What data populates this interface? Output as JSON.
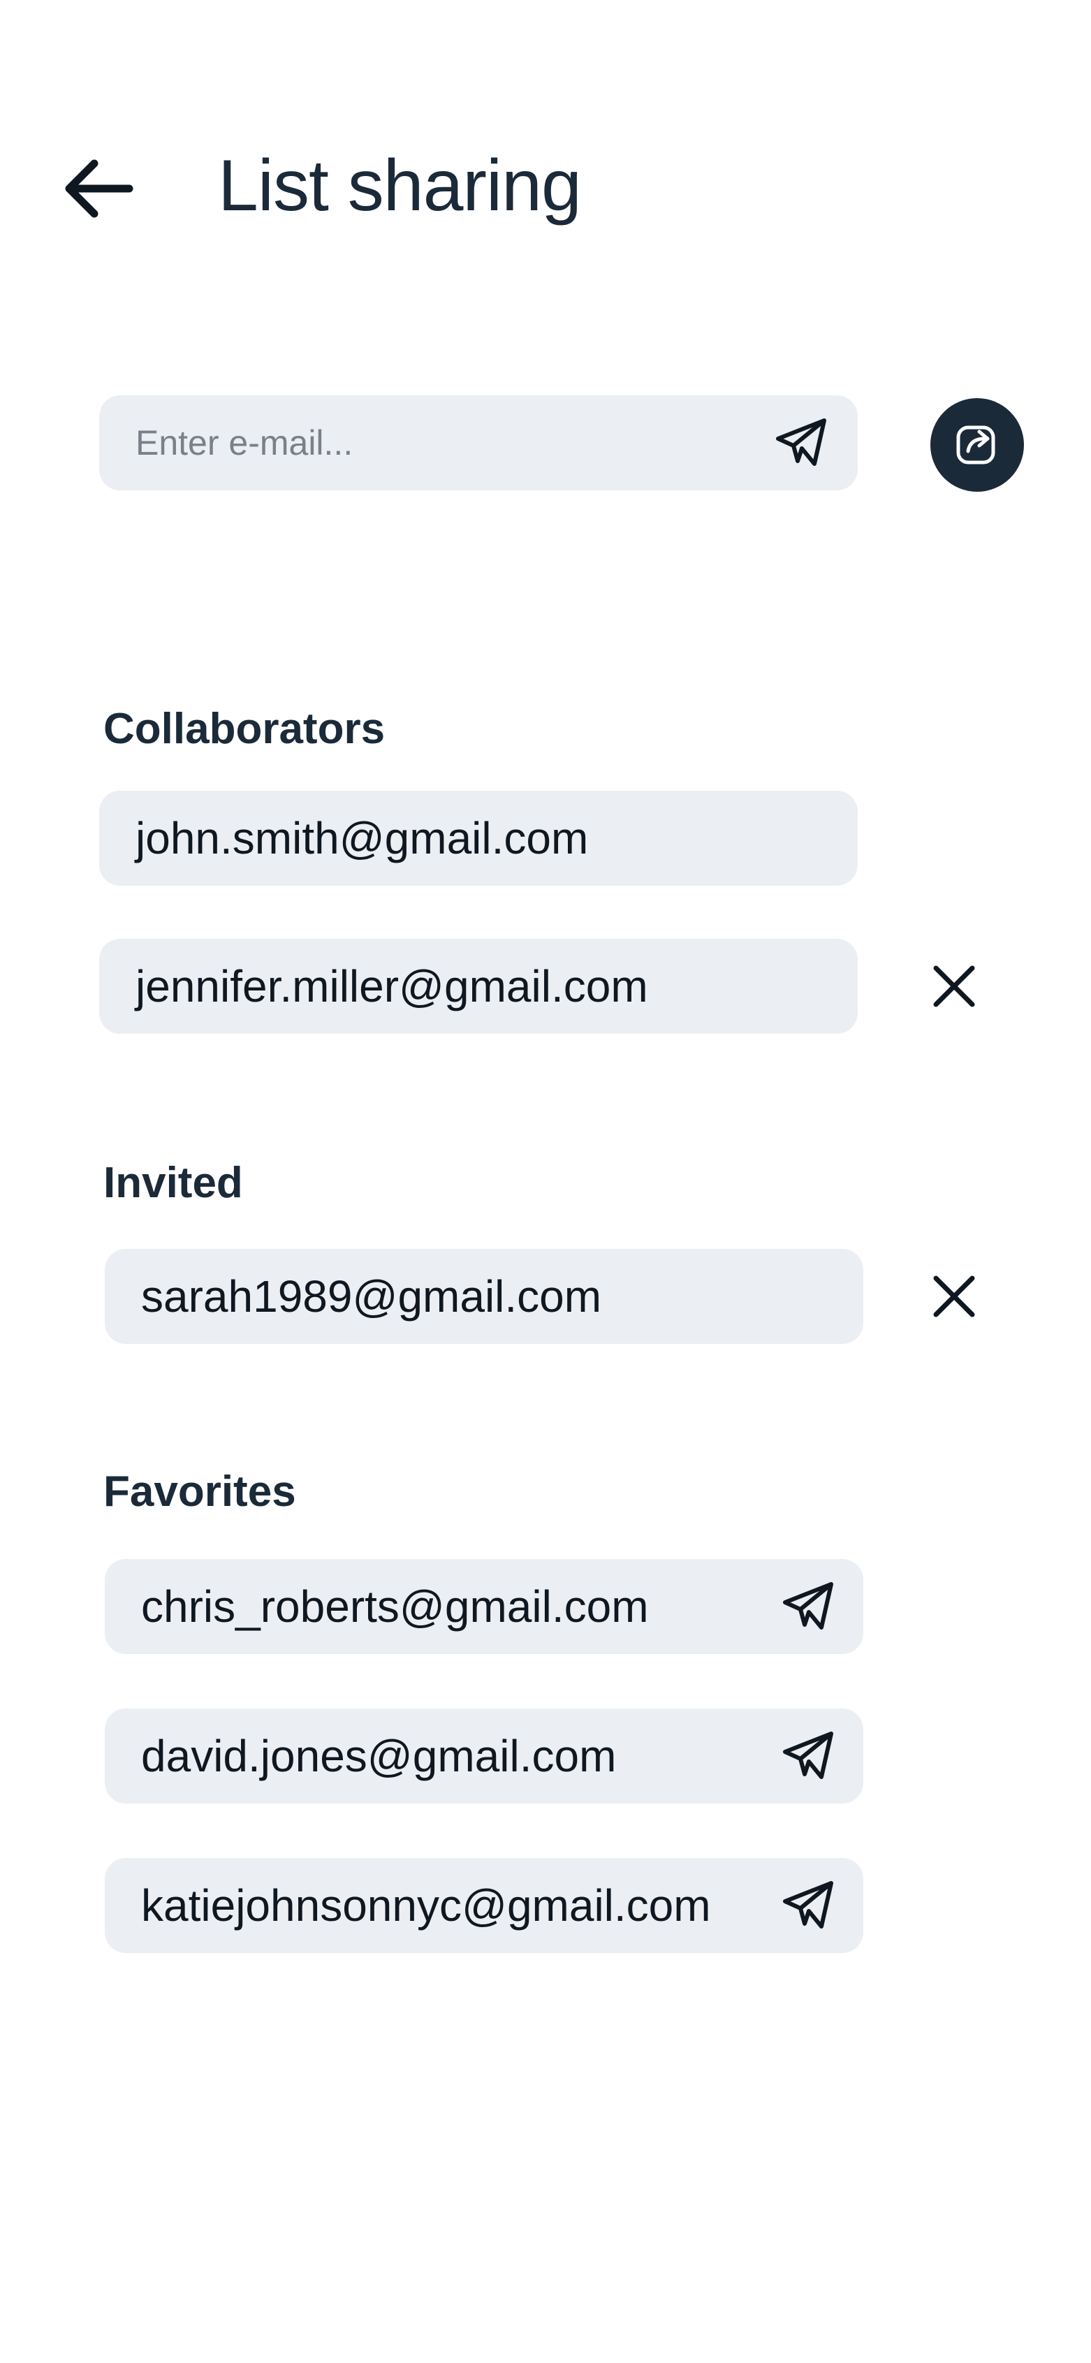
{
  "header": {
    "title": "List sharing"
  },
  "invite": {
    "placeholder": "Enter e-mail..."
  },
  "sections": {
    "collaborators": {
      "label": "Collaborators",
      "items": [
        "john.smith@gmail.com",
        "jennifer.miller@gmail.com"
      ]
    },
    "invited": {
      "label": "Invited",
      "items": [
        "sarah1989@gmail.com"
      ]
    },
    "favorites": {
      "label": "Favorites",
      "items": [
        "chris_roberts@gmail.com",
        "david.jones@gmail.com",
        "katiejohnsonnyc@gmail.com"
      ]
    }
  },
  "icons": {
    "back": "arrow-left-icon",
    "send": "paper-plane-icon",
    "share": "share-icon",
    "remove": "close-icon"
  },
  "colors": {
    "primary": "#1b2a38",
    "field_bg": "#ebeef3",
    "background": "#ffffff"
  }
}
